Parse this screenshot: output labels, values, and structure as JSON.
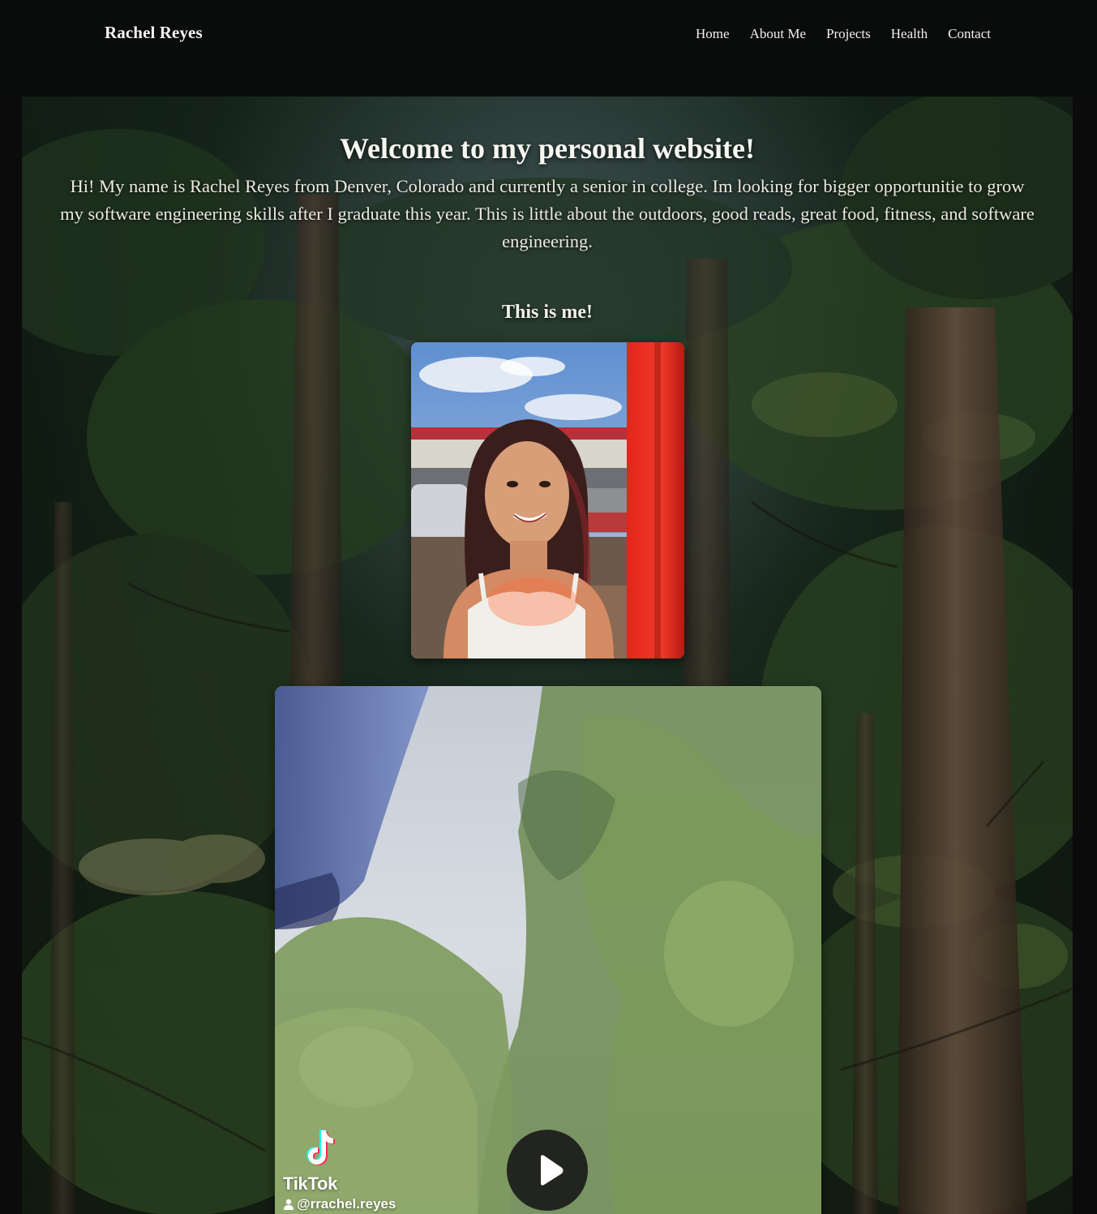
{
  "header": {
    "brand": "Rachel Reyes",
    "nav": [
      {
        "label": "Home"
      },
      {
        "label": "About Me"
      },
      {
        "label": "Projects"
      },
      {
        "label": "Health"
      },
      {
        "label": "Contact"
      }
    ]
  },
  "main": {
    "title": "Welcome to my personal website!",
    "intro": "Hi! My name is Rachel Reyes from Denver, Colorado and currently a senior in college. Im looking for bigger opportunitie to grow my software engineering skills after I graduate this year. This is little about the outdoors, good reads, great food, fitness, and software engineering.",
    "photo_heading": "This is me!",
    "video": {
      "platform_label": "TikTok",
      "handle": "@rrachel.reyes"
    }
  },
  "colors": {
    "page_background": "#070808",
    "nav_text": "#f0f0f0",
    "heading_text": "#f7f7f2",
    "play_button": "#161616"
  },
  "icons": {
    "play": "play-icon",
    "tiktok": "tiktok-logo-icon",
    "user": "user-icon"
  }
}
